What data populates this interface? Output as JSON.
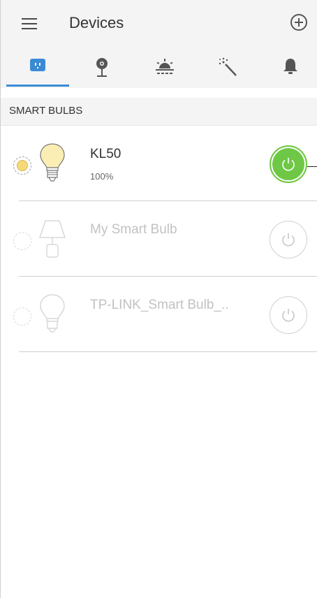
{
  "header": {
    "title": "Devices",
    "menu_icon": "hamburger-menu-icon",
    "add_icon": "plus-circle-icon"
  },
  "tabs": [
    {
      "name": "plug",
      "icon": "smart-plug-icon",
      "active": true
    },
    {
      "name": "camera",
      "icon": "camera-icon",
      "active": false
    },
    {
      "name": "sunrise",
      "icon": "sunrise-icon",
      "active": false
    },
    {
      "name": "magic",
      "icon": "magic-wand-icon",
      "active": false
    },
    {
      "name": "notifications",
      "icon": "bell-icon",
      "active": false
    }
  ],
  "section": {
    "label": "SMART BULBS"
  },
  "devices": [
    {
      "name": "KL50",
      "status": "100%",
      "power_on": true,
      "icon": "light-bulb-icon"
    },
    {
      "name": "My Smart Bulb",
      "status": "",
      "power_on": false,
      "icon": "lamp-icon"
    },
    {
      "name": "TP-LINK_Smart Bulb_..",
      "status": "",
      "power_on": false,
      "icon": "light-bulb-icon"
    }
  ],
  "colors": {
    "accent": "#3b8bd4",
    "power_on": "#6ec845",
    "bulb_on": "#f6d97a",
    "header_bg": "#f4f4f4"
  }
}
